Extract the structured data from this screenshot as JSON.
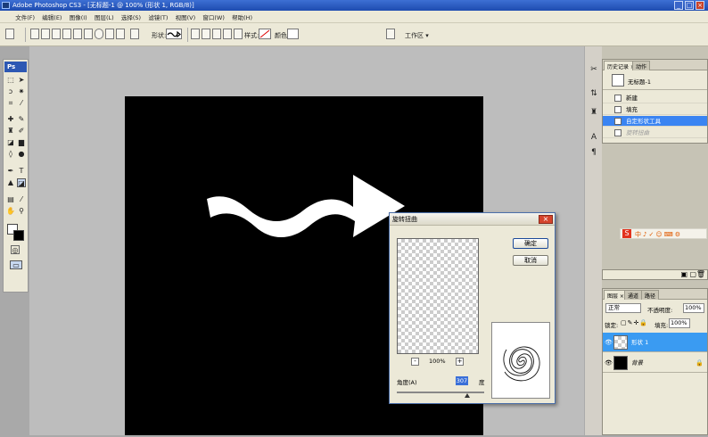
{
  "window": {
    "title": "Adobe Photoshop CS3 - [无标题-1 @ 100% (形状 1, RGB/8)]",
    "min": "_",
    "max": "□",
    "close": "×"
  },
  "menu": [
    "文件(F)",
    "编辑(E)",
    "图像(I)",
    "图层(L)",
    "选择(S)",
    "滤镜(T)",
    "视图(V)",
    "窗口(W)",
    "帮助(H)"
  ],
  "options": {
    "shape_label": "形状:",
    "style_label": "样式:",
    "color_label": "颜色:",
    "workspace_label": "工作区 ▾"
  },
  "toolbox": {
    "logo": "Ps"
  },
  "history": {
    "tabs": [
      "历史记录 ×",
      "动作"
    ],
    "doc_name": "无标题-1",
    "items": [
      {
        "label": "新建",
        "state": "normal"
      },
      {
        "label": "填充",
        "state": "normal"
      },
      {
        "label": "自定形状工具",
        "state": "selected"
      },
      {
        "label": "旋转扭曲",
        "state": "dim"
      }
    ]
  },
  "layers": {
    "tabs": [
      "图层 ×",
      "通道",
      "路径"
    ],
    "blend_mode": "正常",
    "opacity_label": "不透明度:",
    "opacity": "100%",
    "lock_label": "锁定:",
    "fill_label": "填充:",
    "fill": "100%",
    "rows": [
      {
        "name": "形状 1",
        "selected": true
      },
      {
        "name": "背景",
        "selected": false
      }
    ]
  },
  "dialog": {
    "title": "旋转扭曲",
    "ok": "确定",
    "cancel": "取消",
    "zoom": "100%",
    "zoom_out": "-",
    "zoom_in": "+",
    "angle_label": "角度(A)",
    "angle_value": "307",
    "angle_unit": "度"
  },
  "colors": {
    "accent": "#3a84f2",
    "canvas": "#000000",
    "shape": "#ffffff"
  }
}
